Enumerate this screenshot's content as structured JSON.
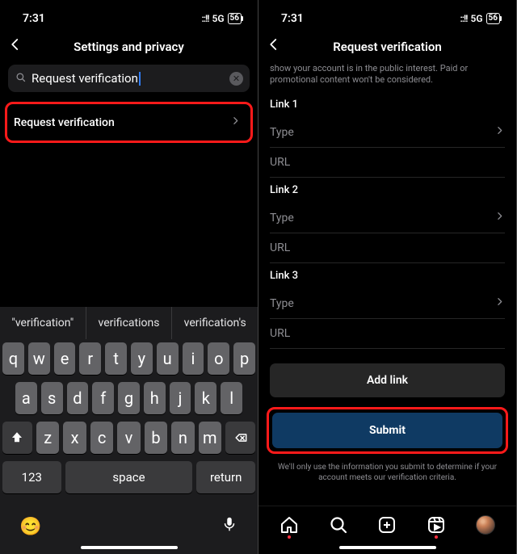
{
  "status": {
    "time": "7:31",
    "network": "5G",
    "battery": "56"
  },
  "left": {
    "title": "Settings and privacy",
    "search_value": "Request verification",
    "result_label": "Request verification",
    "suggestions": [
      "\"verification\"",
      "verifications",
      "verification's"
    ],
    "keys_r1": [
      "q",
      "w",
      "e",
      "r",
      "t",
      "y",
      "u",
      "i",
      "o",
      "p"
    ],
    "keys_r2": [
      "a",
      "s",
      "d",
      "f",
      "g",
      "h",
      "j",
      "k",
      "l"
    ],
    "keys_r3": [
      "z",
      "x",
      "c",
      "v",
      "b",
      "n",
      "m"
    ],
    "key_123": "123",
    "key_space": "space",
    "key_return": "return"
  },
  "right": {
    "title": "Request verification",
    "desc": "show your account is in the public interest. Paid or promotional content won't be considered.",
    "links": [
      {
        "label": "Link 1",
        "type_ph": "Type",
        "url_ph": "URL"
      },
      {
        "label": "Link 2",
        "type_ph": "Type",
        "url_ph": "URL"
      },
      {
        "label": "Link 3",
        "type_ph": "Type",
        "url_ph": "URL"
      }
    ],
    "add_link": "Add link",
    "submit": "Submit",
    "footnote": "We'll only use the information you submit to determine if your account meets our verification criteria."
  }
}
